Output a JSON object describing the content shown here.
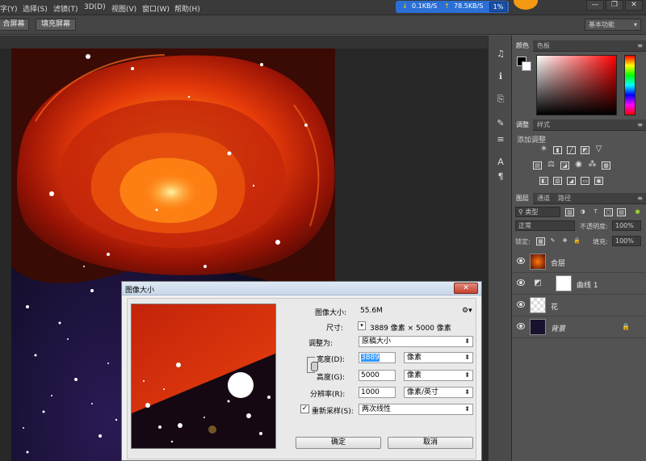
{
  "menu": [
    "字(Y)",
    "选择(S)",
    "滤镜(T)",
    "3D(D)",
    "视图(V)",
    "窗口(W)",
    "帮助(H)"
  ],
  "net": {
    "down": "0.1KB/S",
    "up": "78.5KB/S",
    "percent": "1%"
  },
  "window_buttons": [
    "—",
    "❐",
    "✕"
  ],
  "options_bar": {
    "btn1": "合屏幕",
    "btn2": "填充屏幕",
    "workspace": "基本功能"
  },
  "panels": {
    "color_tabs": [
      "颜色",
      "色板"
    ],
    "adjust_tabs": [
      "调整",
      "样式"
    ],
    "adjust_heading": "添加调整",
    "layers_tabs": [
      "图层",
      "通道",
      "路径"
    ],
    "filter_kind": "类型",
    "blend_mode": "正常",
    "opacity_label": "不透明度:",
    "opacity_value": "100%",
    "lock_label": "锁定:",
    "fill_label": "填充:",
    "fill_value": "100%",
    "layers": [
      "合层",
      "曲线 1",
      "花",
      "背景"
    ]
  },
  "dialog": {
    "title": "图像大小",
    "close": "✕",
    "size_label": "图像大小:",
    "size_value": "55.6M",
    "dims_label": "尺寸:",
    "dims_value": "3889 像素 × 5000 像素",
    "fit_label": "调整为:",
    "fit_value": "原稿大小",
    "width_label": "宽度(D):",
    "width_value": "3889",
    "width_unit": "像素",
    "height_label": "高度(G):",
    "height_value": "5000",
    "height_unit": "像素",
    "res_label": "分辨率(R):",
    "res_value": "1000",
    "res_unit": "像素/英寸",
    "resample_label": "重新采样(S):",
    "resample_value": "两次线性",
    "ok": "确定",
    "cancel": "取消"
  }
}
